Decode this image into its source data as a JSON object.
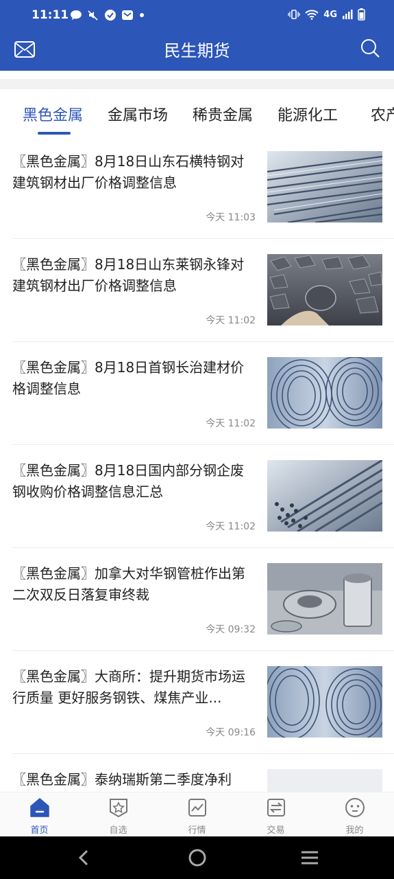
{
  "status_bar": {
    "time": "11:11",
    "network": "4G",
    "left_icons": [
      "message-icon",
      "mute-icon",
      "check-icon",
      "mail-icon",
      "dot-icon"
    ],
    "right_icons": [
      "vibrate-icon",
      "wifi-icon",
      "signal-icon",
      "battery-icon"
    ]
  },
  "app_bar": {
    "title": "民生期货",
    "left_icon": "mail-icon",
    "right_icon": "search-icon"
  },
  "tabs": [
    {
      "label": "黑色金属",
      "active": true
    },
    {
      "label": "金属市场",
      "active": false
    },
    {
      "label": "稀贵金属",
      "active": false
    },
    {
      "label": "能源化工",
      "active": false
    },
    {
      "label": "农产",
      "active": false
    }
  ],
  "news": [
    {
      "headline": "〖黑色金属〗8月18日山东石横特钢对建筑钢材出厂价格调整信息",
      "time": "今天 11:03",
      "thumb": "steel-rebar-bundle"
    },
    {
      "headline": "〖黑色金属〗8月18日山东莱钢永锋对建筑钢材出厂价格调整信息",
      "time": "今天 11:02",
      "thumb": "iron-ore-in-hand"
    },
    {
      "headline": "〖黑色金属〗8月18日首钢长治建材价格调整信息",
      "time": "今天 11:02",
      "thumb": "wire-rod-coils"
    },
    {
      "headline": "〖黑色金属〗8月18日国内部分钢企废钢收购价格调整信息汇总",
      "time": "今天 11:02",
      "thumb": "steel-bar-ends"
    },
    {
      "headline": "〖黑色金属〗加拿大对华钢管桩作出第二次双反日落复审终裁",
      "time": "今天 09:32",
      "thumb": "steel-pipe-parts"
    },
    {
      "headline": "〖黑色金属〗大商所：提升期货市场运行质量 更好服务钢铁、煤焦产业...",
      "time": "今天 09:16",
      "thumb": "wire-rod-coils"
    },
    {
      "headline": "〖黑色金属〗泰纳瑞斯第二季度净利",
      "time": "",
      "thumb": "placeholder"
    }
  ],
  "bottom_nav": [
    {
      "label": "首页",
      "icon": "home-icon",
      "active": true
    },
    {
      "label": "自选",
      "icon": "star-badge-icon",
      "active": false
    },
    {
      "label": "行情",
      "icon": "chart-icon",
      "active": false
    },
    {
      "label": "交易",
      "icon": "exchange-icon",
      "active": false
    },
    {
      "label": "我的",
      "icon": "profile-face-icon",
      "active": false
    }
  ],
  "colors": {
    "brand": "#2c56b8",
    "text": "#222222",
    "muted": "#888888",
    "divider": "#ececec"
  }
}
